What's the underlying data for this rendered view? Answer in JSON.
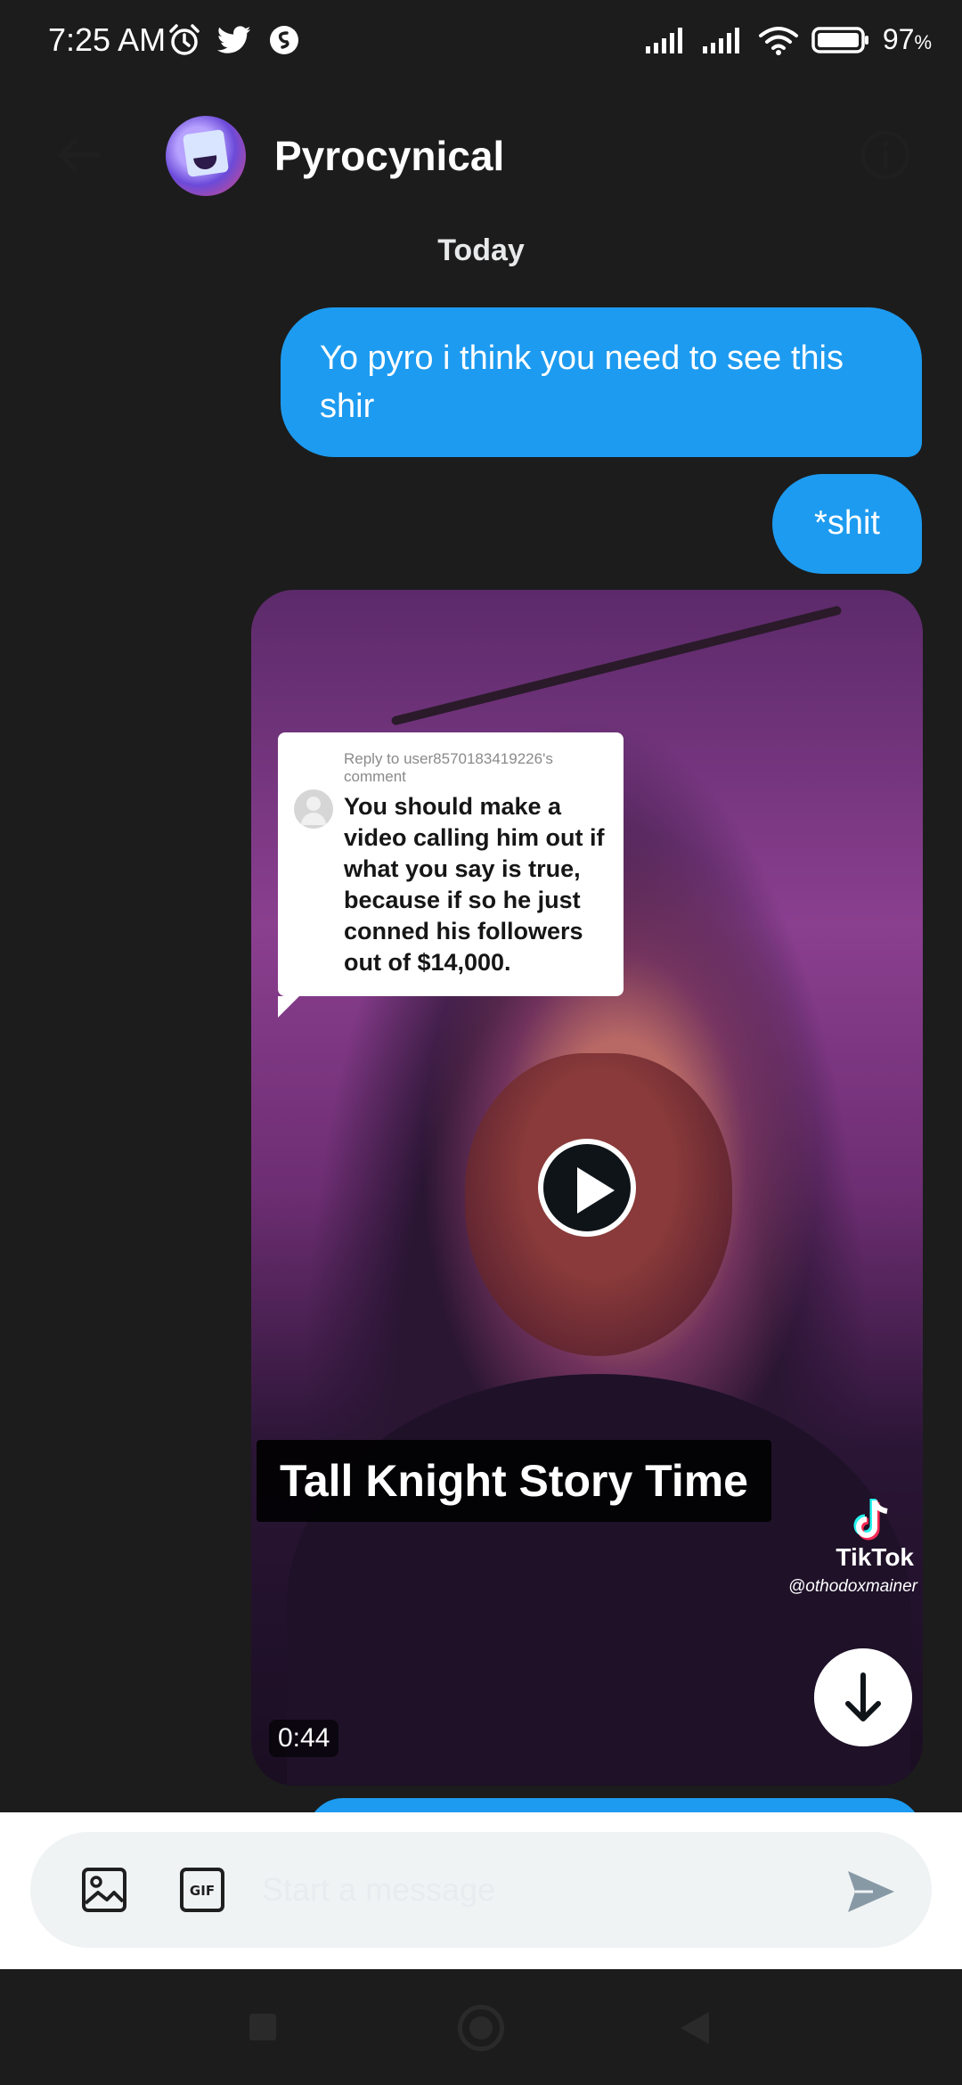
{
  "status_bar": {
    "time": "7:25 AM",
    "battery_percent": "97",
    "battery_suffix": "%",
    "icons": [
      "alarm-icon",
      "twitter-bird-icon",
      "shazam-icon",
      "signal-icon",
      "signal-icon",
      "wifi-icon",
      "battery-icon"
    ]
  },
  "header": {
    "name": "Pyrocynical",
    "back_icon": "back-arrow-icon",
    "info_icon": "info-icon"
  },
  "date_separator": "Today",
  "messages": [
    {
      "text": "Yo pyro i think you need to see this shir"
    },
    {
      "text": "*shit"
    }
  ],
  "video": {
    "comment_reply": "Reply to user8570183419226's comment",
    "comment_text": "You should make a video calling him out if what you say is true, because if so he just conned his followers out of $14,000.",
    "caption": "Tall Knight Story Time",
    "watermark_brand": "TikTok",
    "watermark_handle": "@othodoxmainer",
    "duration": "0:44"
  },
  "composer": {
    "placeholder": "Start a message",
    "value": ""
  },
  "colors": {
    "background": "#1c1c1c",
    "bubble": "#1d9bf0",
    "composer_bg": "#eff3f4"
  }
}
